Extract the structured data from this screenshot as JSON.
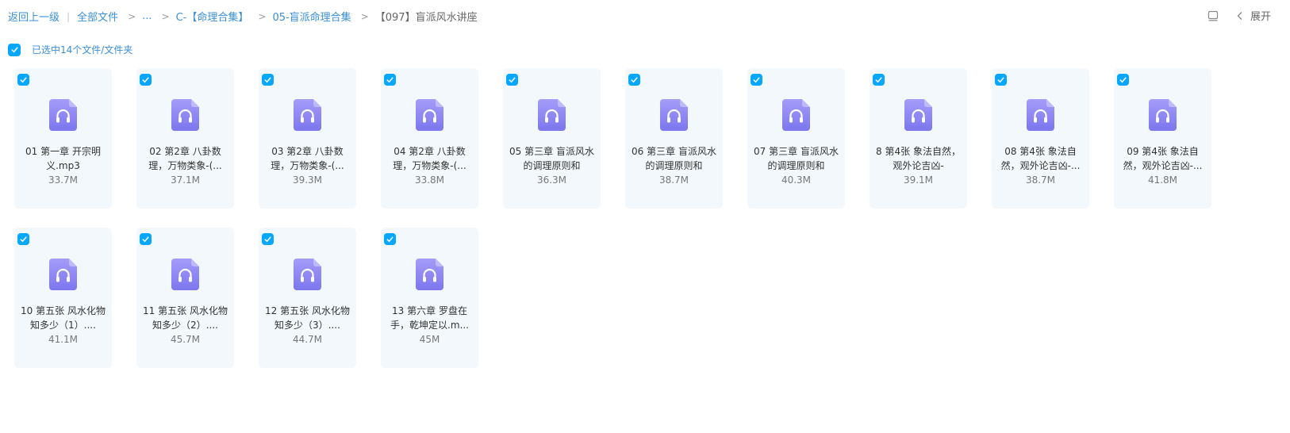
{
  "breadcrumb": {
    "back_label": "返回上一级",
    "items": [
      {
        "label": "全部文件"
      },
      {
        "label": "..."
      },
      {
        "label": "C-【命理合集】"
      },
      {
        "label": "05-盲派命理合集"
      },
      {
        "label": "【097】盲派风水讲座"
      }
    ],
    "separator": ">"
  },
  "toolbar": {
    "expand_label": "展开",
    "icons": [
      "panel-toggle-icon",
      "chevron-left-icon"
    ]
  },
  "selection": {
    "text": "已选中14个文件/文件夹",
    "checked": true
  },
  "files": [
    {
      "name": "01 第一章 开宗明义.mp3",
      "size": "33.7M",
      "icon": "audio-file-icon"
    },
    {
      "name": "02 第2章 八卦数理，万物类象-(...",
      "size": "37.1M",
      "icon": "audio-file-icon"
    },
    {
      "name": "03 第2章 八卦数理，万物类象-(...",
      "size": "39.3M",
      "icon": "audio-file-icon"
    },
    {
      "name": "04 第2章 八卦数理，万物类象-(...",
      "size": "33.8M",
      "icon": "audio-file-icon"
    },
    {
      "name": "05 第三章 盲派风水的调理原则和",
      "size": "36.3M",
      "icon": "audio-file-icon"
    },
    {
      "name": "06 第三章 盲派风水的调理原则和",
      "size": "38.7M",
      "icon": "audio-file-icon"
    },
    {
      "name": "07 第三章 盲派风水的调理原则和",
      "size": "40.3M",
      "icon": "audio-file-icon"
    },
    {
      "name": "8 第4张 象法自然，观外论吉凶-",
      "size": "39.1M",
      "icon": "audio-file-icon"
    },
    {
      "name": "08 第4张 象法自然，观外论吉凶-...",
      "size": "38.7M",
      "icon": "audio-file-icon"
    },
    {
      "name": "09 第4张 象法自然，观外论吉凶-...",
      "size": "41.8M",
      "icon": "audio-file-icon"
    },
    {
      "name": "10 第五张 风水化物知多少（1）....",
      "size": "41.1M",
      "icon": "audio-file-icon"
    },
    {
      "name": "11 第五张 风水化物知多少（2）....",
      "size": "45.7M",
      "icon": "audio-file-icon"
    },
    {
      "name": "12 第五张 风水化物知多少（3）....",
      "size": "44.7M",
      "icon": "audio-file-icon"
    },
    {
      "name": "13 第六章 罗盘在手，乾坤定以.m...",
      "size": "45M",
      "icon": "audio-file-icon"
    }
  ],
  "colors": {
    "accent": "#06a7ff",
    "link": "#3a8fd6",
    "card_bg": "#f2f8fc",
    "icon_top": "#a59cf8",
    "icon_bottom": "#7d76ee"
  }
}
